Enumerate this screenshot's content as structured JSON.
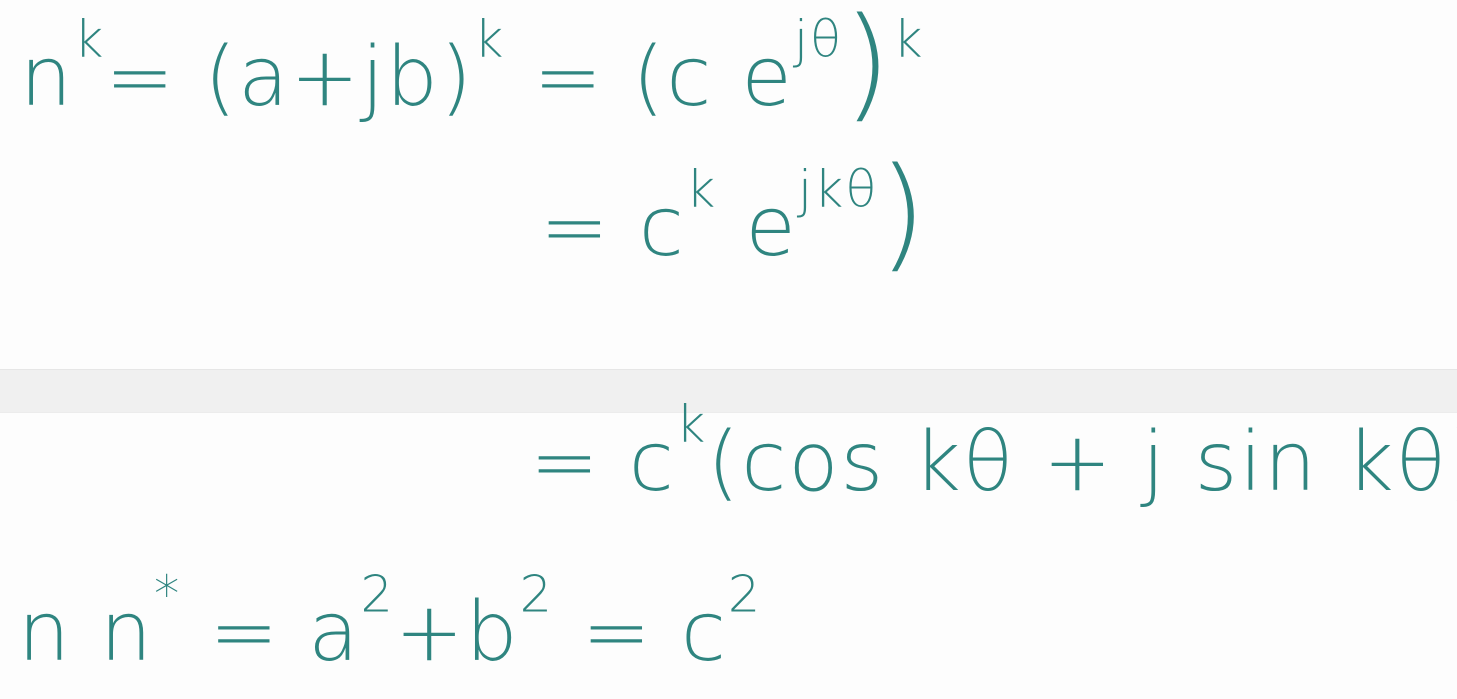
{
  "notes": {
    "line1": {
      "lhs": "n",
      "lhs_exp": "k",
      "expr1": "= (a+jb)",
      "expr1_exp": "k",
      "expr2": "= (c e",
      "expr2_exp": "jθ",
      "expr2_close": ")",
      "expr2_outer_exp": "k"
    },
    "line2": {
      "prefix": "= c",
      "prefix_exp": "k",
      "mid": " e",
      "mid_exp": "jkθ",
      "close": ")"
    },
    "line3": {
      "prefix": "= c",
      "prefix_exp": "k",
      "body": "(cos kθ + j sin kθ)"
    },
    "line4": {
      "lhs": "n n",
      "lhs_exp": "*",
      "eq1": " = a",
      "eq1_exp": "2",
      "plus": "+b",
      "plus_exp": "2",
      "eq2": " = c",
      "eq2_exp": "2"
    }
  }
}
